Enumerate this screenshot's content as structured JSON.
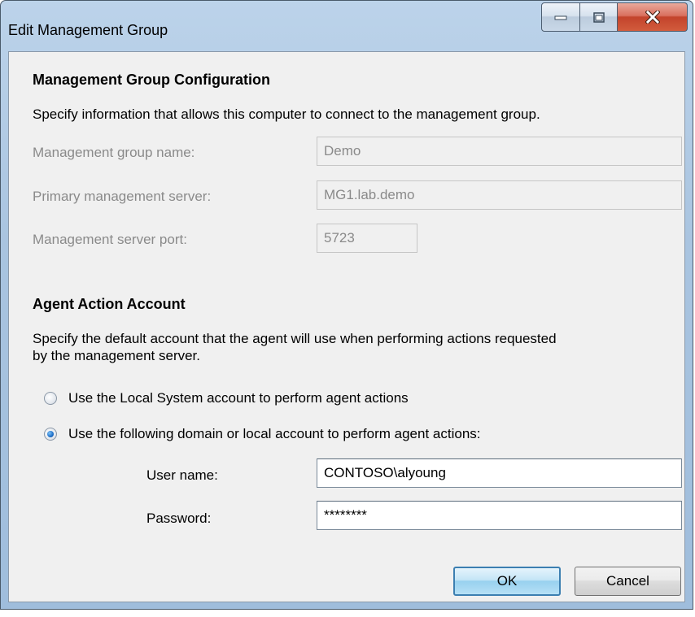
{
  "window": {
    "title": "Edit Management Group"
  },
  "mgmt_group": {
    "heading": "Management Group Configuration",
    "description": "Specify information that allows this computer to connect to the management group.",
    "name_label": "Management group name:",
    "name_value": "Demo",
    "server_label": "Primary management server:",
    "server_value": "MG1.lab.demo",
    "port_label": "Management server port:",
    "port_value": "5723"
  },
  "action_account": {
    "heading": "Agent Action Account",
    "description_line1": "Specify the default account that the agent will use when performing actions requested",
    "description_line2": "by the management server.",
    "option_local_system": "Use the Local System account to perform agent actions",
    "option_domain_account": "Use the following domain or local account to perform agent actions:",
    "selected_option": "domain_account",
    "username_label": "User name:",
    "username_value": "CONTOSO\\alyoung",
    "password_label": "Password:",
    "password_value": "********"
  },
  "buttons": {
    "ok": "OK",
    "cancel": "Cancel"
  },
  "colors": {
    "title_bar": "#a9c4e0",
    "close_button": "#c3432b",
    "ok_button": "#98d1ef",
    "dialog_background": "#f0f0f0"
  }
}
